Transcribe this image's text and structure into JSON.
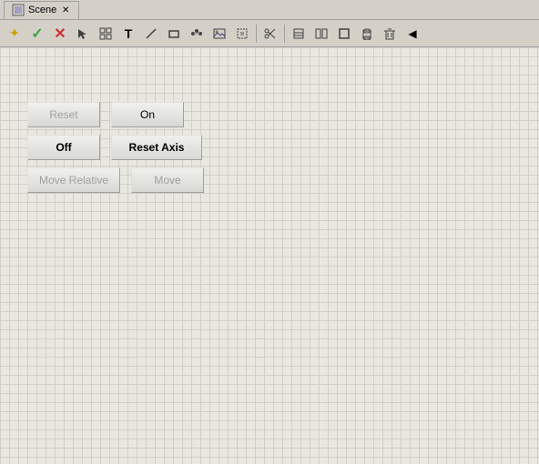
{
  "window": {
    "title": "Scene",
    "tab_close": "✕"
  },
  "toolbar": {
    "buttons": [
      {
        "name": "star-icon",
        "symbol": "✦",
        "class": "icon-star"
      },
      {
        "name": "check-icon",
        "symbol": "✓",
        "class": "icon-check"
      },
      {
        "name": "x-icon",
        "symbol": "✕",
        "class": "icon-x"
      },
      {
        "name": "arrow-icon",
        "symbol": "↖",
        "class": "icon-arrow"
      },
      {
        "name": "grid-icon",
        "symbol": "⊞",
        "class": "icon-grid"
      },
      {
        "name": "text-icon",
        "symbol": "T",
        "class": "icon-text"
      },
      {
        "name": "line-icon",
        "symbol": "╱",
        "class": ""
      },
      {
        "name": "rect-icon",
        "symbol": "▭",
        "class": ""
      },
      {
        "name": "dots-icon",
        "symbol": "⠿",
        "class": ""
      },
      {
        "name": "photo-icon",
        "symbol": "⬜",
        "class": ""
      },
      {
        "name": "select-icon",
        "symbol": "⊡",
        "class": ""
      },
      {
        "name": "sep1",
        "symbol": "|",
        "class": ""
      },
      {
        "name": "tool1-icon",
        "symbol": "⚒",
        "class": ""
      },
      {
        "name": "sep2",
        "symbol": "|",
        "class": ""
      },
      {
        "name": "tool2-icon",
        "symbol": "◧",
        "class": ""
      },
      {
        "name": "tool3-icon",
        "symbol": "◨",
        "class": ""
      },
      {
        "name": "tool4-icon",
        "symbol": "◻",
        "class": ""
      },
      {
        "name": "tool5-icon",
        "symbol": "⬚",
        "class": ""
      },
      {
        "name": "tool6-icon",
        "symbol": "⬛",
        "class": ""
      },
      {
        "name": "arrow-left-icon",
        "symbol": "◀",
        "class": ""
      }
    ]
  },
  "buttons": {
    "reset_label": "Reset",
    "on_label": "On",
    "off_label": "Off",
    "reset_axis_label": "Reset Axis",
    "move_relative_label": "Move Relative",
    "move_label": "Move"
  }
}
